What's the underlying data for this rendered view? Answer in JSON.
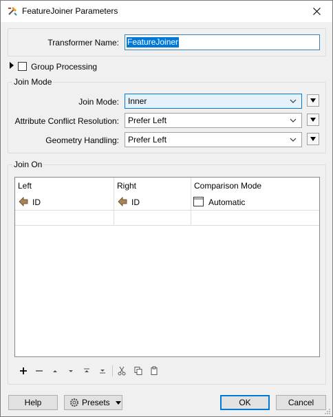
{
  "window": {
    "title": "FeatureJoiner Parameters"
  },
  "transformer_name": {
    "label": "Transformer Name:",
    "value": "FeatureJoiner"
  },
  "group_processing": {
    "label": "Group Processing",
    "checked": false
  },
  "join_mode_section": {
    "title": "Join Mode",
    "join_mode": {
      "label": "Join Mode:",
      "value": "Inner"
    },
    "attribute_conflict": {
      "label": "Attribute Conflict Resolution:",
      "value": "Prefer Left"
    },
    "geometry_handling": {
      "label": "Geometry Handling:",
      "value": "Prefer Left"
    }
  },
  "join_on_section": {
    "title": "Join On",
    "columns": [
      "Left",
      "Right",
      "Comparison Mode"
    ],
    "rows": [
      {
        "left": "ID",
        "right": "ID",
        "comparison": "Automatic"
      }
    ]
  },
  "table_toolbar": [
    "add-icon",
    "remove-icon",
    "move-up-icon",
    "move-down-icon",
    "move-top-icon",
    "move-bottom-icon",
    "cut-icon",
    "copy-icon",
    "paste-icon"
  ],
  "buttons": {
    "help": "Help",
    "presets": "Presets",
    "ok": "OK",
    "cancel": "Cancel"
  },
  "colors": {
    "accent": "#0078d7",
    "attribute_icon": "#a98353"
  }
}
